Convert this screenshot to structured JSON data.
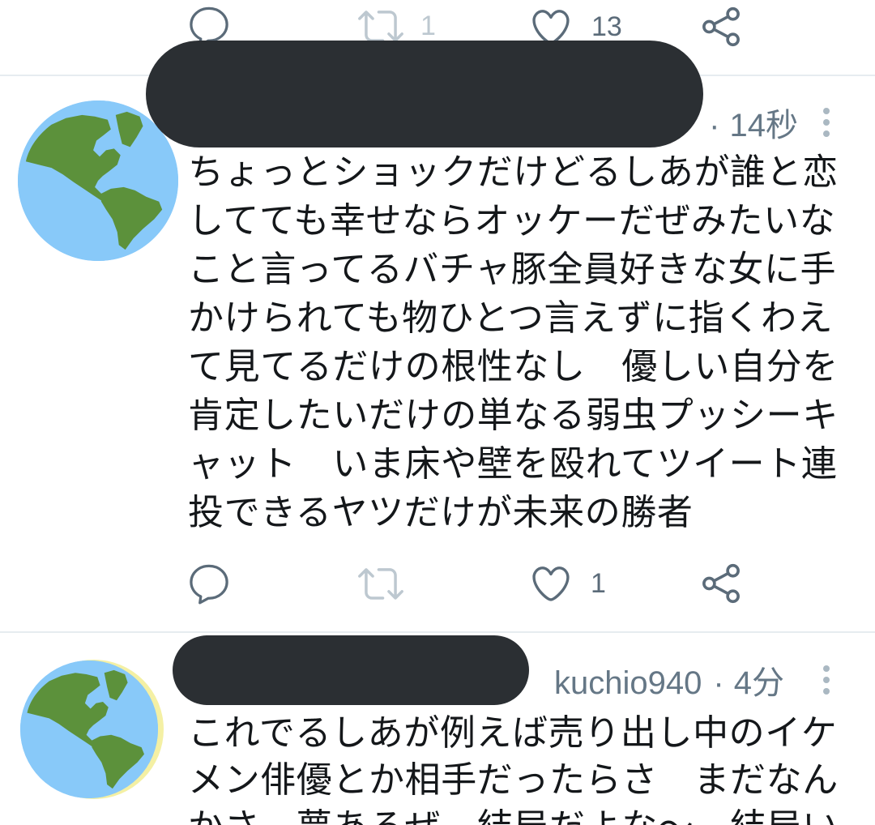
{
  "colors": {
    "background": "#ffffff",
    "text": "#14171a",
    "meta": "#657786",
    "icon": "#5b6b79",
    "icon_disabled": "#bdc8d0",
    "divider": "#e6ecf0",
    "redaction": "#2b2f33",
    "more_dots": "#aab8c2",
    "globe_ocean": "#88c9f9",
    "globe_land": "#5c913b",
    "avatar_rim": "#f4f0a4"
  },
  "icons": {
    "reply": "reply-icon",
    "retweet": "retweet-icon",
    "like": "heart-icon",
    "share": "share-icon",
    "more": "more-options-icon",
    "avatar": "earth-globe-icon"
  },
  "previous_tweet": {
    "actions": {
      "retweet_count": "1",
      "like_count": "13"
    }
  },
  "tweets": [
    {
      "separator": "·",
      "timestamp": "14秒",
      "text_lines": [
        "ちょっとショックだけどるしあが誰と恋",
        "してても幸せならオッケーだぜみたいな",
        "こと言ってるバチャ豚全員好きな女に手",
        "かけられても物ひとつ言えずに指くわえ",
        "て見てるだけの根性なし　優しい自分を",
        "肯定したいだけの単なる弱虫プッシーキ",
        "ャット　いま床や壁を殴れてツイート連",
        "投できるヤツだけが未来の勝者"
      ],
      "actions": {
        "like_count": "1"
      }
    },
    {
      "handle": "kuchio940",
      "separator": "·",
      "timestamp": "4分",
      "text_lines": [
        "これでるしあが例えば売り出し中のイケ",
        "メン俳優とか相手だったらさ　まだなん",
        "かさ　夢あるぜ　結局だよな〜　結局い"
      ]
    }
  ]
}
